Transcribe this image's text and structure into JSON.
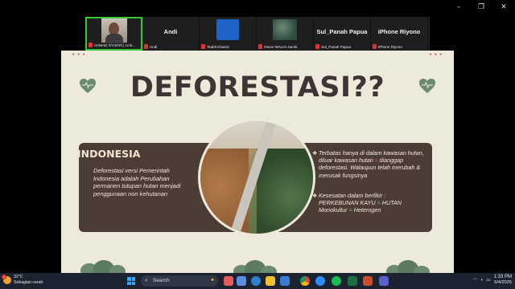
{
  "window_controls": {
    "minimize": "–",
    "restore": "❐",
    "close": "✕"
  },
  "participants": [
    {
      "tile_name": "",
      "label": "AHMAD SYUKRI | Link...",
      "active": true,
      "media": "photo"
    },
    {
      "tile_name": "Andi",
      "label": "Andi",
      "active": false,
      "media": "none"
    },
    {
      "tile_name": "",
      "label": "Tsabit Khairul",
      "active": false,
      "media": "blue"
    },
    {
      "tile_name": "",
      "label": "Oscar WALHI Jambi",
      "active": false,
      "media": "tree"
    },
    {
      "tile_name": "Sul_Panah Papua",
      "label": "Sul_Panah Papua",
      "active": false,
      "media": "none"
    },
    {
      "tile_name": "iPhone Riyono",
      "label": "iPhone Riyono",
      "active": false,
      "media": "none"
    }
  ],
  "slide": {
    "dots": "• • •",
    "title": "DEFORESTASI??",
    "panel_heading": "INDONESIA",
    "definition": "Deforestasi versi Pemerintah Indonesia adalah Perubahan permanen tutupan hutan menjadi penggunaan non kehutanan",
    "bullet1_a": "Terbatas hanya di dalam kawasan hutan, diluar kawasan hutan",
    "bullet1_x": "x",
    "bullet1_b": "dianggap deforestasi. Walaupun telah merubah & merusak fungsinya",
    "bullet2_a": "Kesesatan dalam berfikir :",
    "bullet2_b1": "PERKEBUNAN KAYU",
    "bullet2_eq1": "=",
    "bullet2_b2": "HUTAN",
    "bullet2_c1": "Monokultur",
    "bullet2_eq2": "=",
    "bullet2_c2": "Heterogen",
    "bullet_mark": "❖"
  },
  "taskbar": {
    "weather_temp": "32°C",
    "weather_desc": "Sebagian cerah",
    "weather_badge": "1",
    "search_placeholder": "Search",
    "search_icon": "⌕",
    "time": "1:33 PM",
    "date": "6/4/2025",
    "apps": [
      "edge",
      "files",
      "store",
      "chrome",
      "zoom",
      "spotify",
      "excel",
      "ppt",
      "teams"
    ]
  },
  "colors": {
    "slide_bg": "#eeeadb",
    "panel": "#4b3d36",
    "title": "#3f3433",
    "accent_red": "#b04a3e",
    "leaf_green": "#6c8a6f",
    "active_border": "#37c837"
  }
}
